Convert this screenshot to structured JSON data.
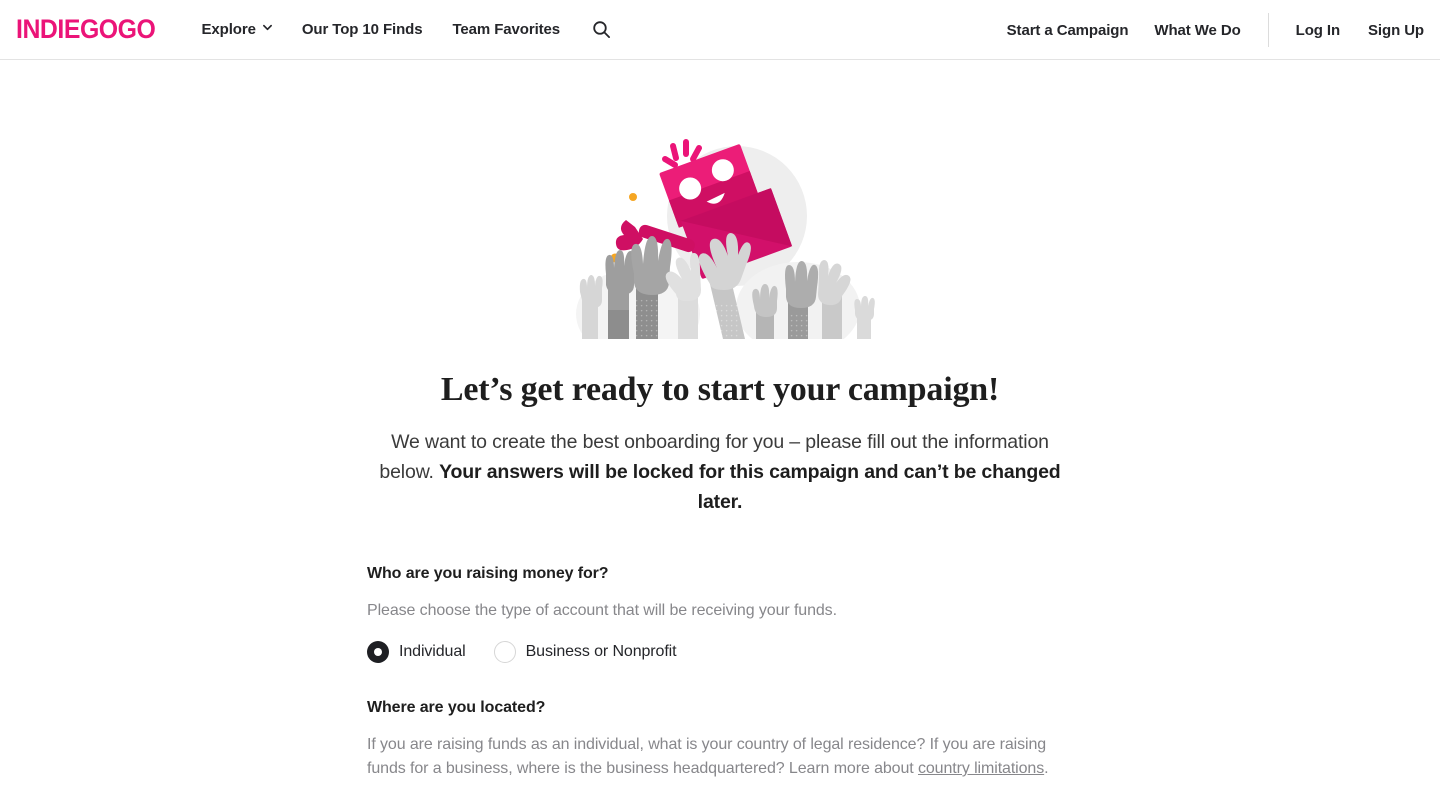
{
  "brand": {
    "logo_text": "INDIEGOGO",
    "pink": "#eb1478",
    "ink": "#1e1e1e",
    "muted": "#87878b"
  },
  "header": {
    "nav_left": [
      {
        "label": "Explore",
        "icon": "chevron-down-icon"
      },
      {
        "label": "Our Top 10 Finds"
      },
      {
        "label": "Team Favorites"
      }
    ],
    "search_icon": "search-icon",
    "nav_right": [
      {
        "label": "Start a Campaign"
      },
      {
        "label": "What We Do"
      },
      {
        "label": "Log In"
      },
      {
        "label": "Sign Up"
      }
    ]
  },
  "hero": {
    "illustration_name": "robot-tossed-by-hands-illustration",
    "headline": "Let’s get ready to start your campaign!",
    "subhead_part_1": "We want to create the best onboarding for you – please fill out the information below. ",
    "subhead_bold": "Your answers will be locked for this campaign and can’t be changed later."
  },
  "form": {
    "fields": [
      {
        "title": "Who are you raising money for?",
        "description": "Please choose the type of account that will be receiving your funds.",
        "options": [
          {
            "label": "Individual",
            "selected": true
          },
          {
            "label": "Business or Nonprofit",
            "selected": false
          }
        ]
      },
      {
        "title": "Where are you located?",
        "description_part_1": "If you are raising funds as an individual, what is your country of legal residence? If you are raising funds for a business, where is the business headquartered? Learn more about ",
        "description_link": "country limitations",
        "description_part_2": "."
      }
    ]
  }
}
